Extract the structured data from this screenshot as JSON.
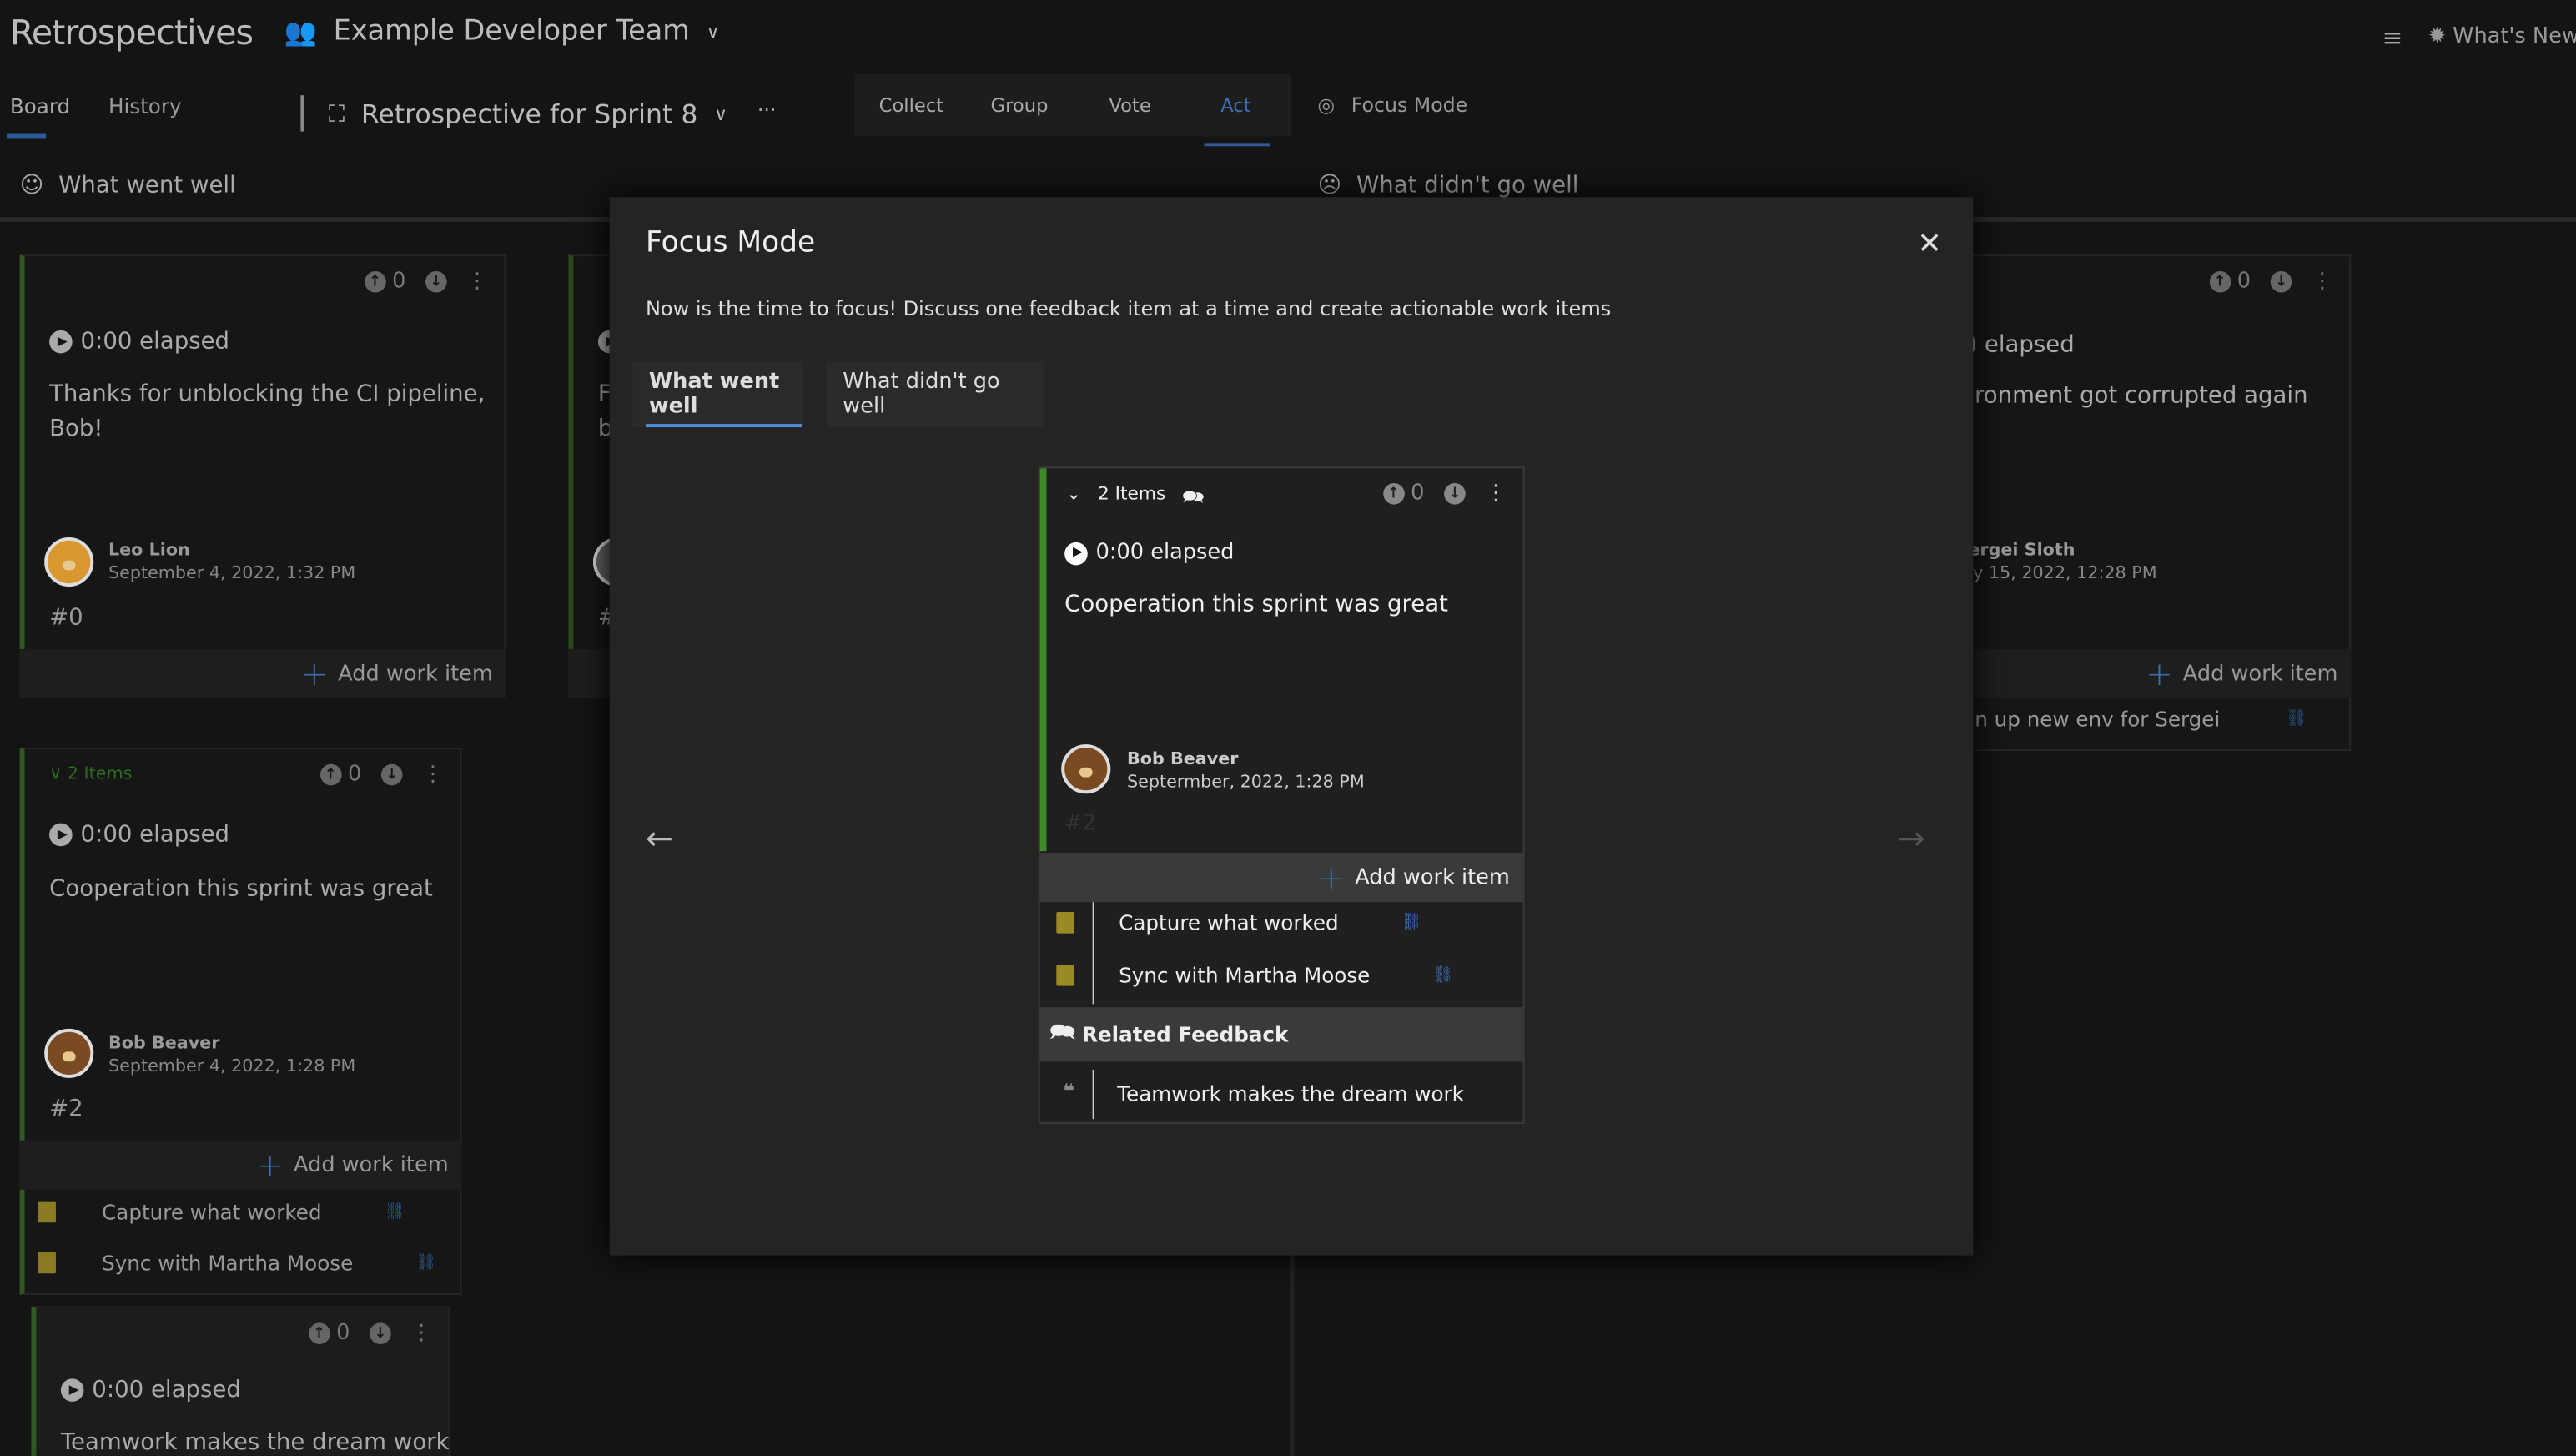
{
  "header": {
    "app_title": "Retrospectives",
    "team": "Example Developer Team",
    "whats_new": "What's New"
  },
  "nav": {
    "tabs": [
      "Board",
      "History"
    ],
    "active_tab": "Board",
    "retro_title": "Retrospective for Sprint 8",
    "more": "···"
  },
  "phases": {
    "items": [
      "Collect",
      "Group",
      "Vote",
      "Act"
    ],
    "active": "Act",
    "focus_mode": "Focus Mode"
  },
  "columns": {
    "left": "What went well",
    "right": "What didn't go well"
  },
  "colors": {
    "accent": "#4a8fe0",
    "good": "#3b8a25",
    "workitem": "#c9b037"
  },
  "board": {
    "card0": {
      "votes": "0",
      "elapsed": "0:00 elapsed",
      "text": "Thanks for unblocking the CI pipeline, Bob!",
      "author": "Leo Lion",
      "date": "September 4, 2022, 1:32 PM",
      "num": "#0",
      "add": "Add work item"
    },
    "card1": {
      "letters1": "F",
      "letters2": "b",
      "num": "#"
    },
    "card2": {
      "group": "2 Items",
      "votes": "0",
      "elapsed": "0:00 elapsed",
      "text": "Cooperation this sprint was great",
      "author": "Bob Beaver",
      "date": "September 4, 2022, 1:28 PM",
      "num": "#2",
      "add": "Add work item",
      "work_items": [
        "Capture what worked",
        "Sync with Martha Moose"
      ]
    },
    "card3": {
      "votes": "0",
      "elapsed": "0:00 elapsed",
      "text": "Teamwork makes the dream work"
    },
    "right_card": {
      "votes": "0",
      "elapsed": ") elapsed",
      "text": "ironment got corrupted again",
      "author": "ergei Sloth",
      "date": "ly 15, 2022, 12:28 PM",
      "add": "Add work item",
      "work_item": "n up new env for Sergei"
    }
  },
  "modal": {
    "title": "Focus Mode",
    "description": "Now is the time to focus! Discuss one feedback item at a time and create actionable work items",
    "tabs": [
      "What went well",
      "What didn't go well"
    ],
    "active_tab": "What went well",
    "card": {
      "group": "2 Items",
      "votes": "0",
      "elapsed": "0:00 elapsed",
      "text": "Cooperation this sprint was great",
      "author": "Bob Beaver",
      "date": "Septermber, 2022, 1:28 PM",
      "num": "#2",
      "add": "Add work item",
      "work_items": [
        "Capture what worked",
        "Sync with Martha Moose"
      ],
      "related_title": "Related Feedback",
      "related": [
        "Teamwork makes the dream work"
      ]
    },
    "prev": "←",
    "next": "→"
  }
}
